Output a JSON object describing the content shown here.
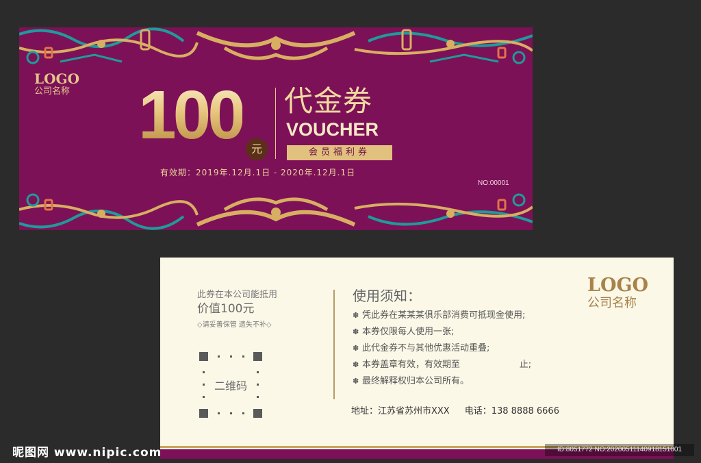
{
  "front": {
    "logo": "LOGO",
    "company": "公司名称",
    "amount": "100",
    "currency": "元",
    "title_cn": "代金券",
    "title_en": "VOUCHER",
    "member": "会员福利券",
    "validity": "有效期：2019年.12月.1日  -  2020年.12月.1日",
    "serial": "NO:00001"
  },
  "back": {
    "left_line1": "此券在本公司能抵用",
    "left_line2": "价值100元",
    "left_line3": "◇请妥善保管 遗失不补◇",
    "qr_label": "二维码",
    "notes_title": "使用须知：",
    "notes": [
      "凭此券在某某某俱乐部消费可抵现金使用;",
      "本券仅限每人使用一张;",
      "此代金券不与其他优惠活动重叠;",
      "本券盖章有效，有效期至                     止;",
      "最终解释权归本公司所有。"
    ],
    "address": "地址：江苏省苏州市XXX",
    "phone": "电话：138 8888 6666",
    "logo": "LOGO",
    "company": "公司名称"
  },
  "watermark": {
    "site": "昵图网 www.nipic.com",
    "id": "ID:8051772 NO:20200511140918151001"
  },
  "colors": {
    "background": "#2b2b2b",
    "voucher_purple": "#7d1157",
    "gold": "#e3c58c",
    "teal": "#1d9c9a",
    "cream": "#fbf8e8"
  },
  "icons": [
    "ornament-border",
    "qr-placeholder-icon",
    "bullet-icon"
  ]
}
